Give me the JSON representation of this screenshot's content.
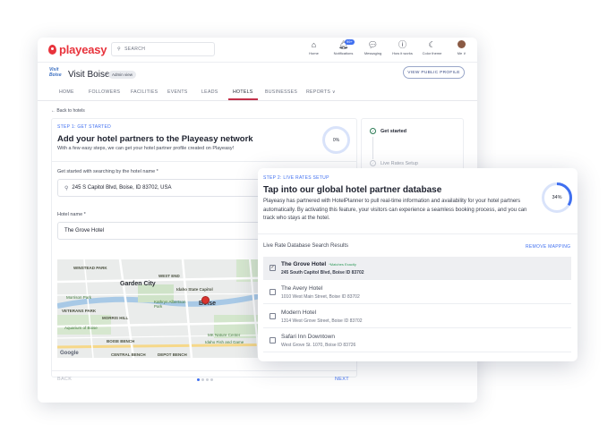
{
  "brand": {
    "name": "playeasy",
    "accent": "#e8333c",
    "link_color": "#3f6ff0"
  },
  "topbar": {
    "search_placeholder": "SEARCH",
    "nav": [
      {
        "icon": "home-icon",
        "glyph": "⌂",
        "label": "Home"
      },
      {
        "icon": "bell-icon",
        "glyph": "♪",
        "label": "Notifications",
        "badge": "99+"
      },
      {
        "icon": "chat-icon",
        "glyph": "✉",
        "label": "Messaging"
      },
      {
        "icon": "help-icon",
        "glyph": "?",
        "label": "How it works"
      },
      {
        "icon": "moon-icon",
        "glyph": "☾",
        "label": "Color theme"
      },
      {
        "icon": "avatar-icon",
        "glyph": "",
        "label": "Me ∨"
      }
    ]
  },
  "org": {
    "logo_text": "Visit Boise",
    "name": "Visit Boise",
    "badge": "Admin view",
    "public_button": "VIEW PUBLIC PROFILE"
  },
  "tabs": [
    "HOME",
    "FOLLOWERS",
    "FACILITIES",
    "EVENTS",
    "LEADS",
    "HOTELS",
    "BUSINESSES",
    "REPORTS ∨"
  ],
  "active_tab": "HOTELS",
  "back_link": "← Back to hotels",
  "step1": {
    "label": "STEP 1: GET STARTED",
    "title": "Add your hotel partners to the Playeasy network",
    "subtitle": "With a few easy steps, we can get your hotel partner profile created on Playeasy!",
    "progress": "0%",
    "search_label": "Get started with searching by the hotel name *",
    "search_value": "245 S Capitol Blvd, Boise, ID 83702, USA",
    "hotel_label": "Hotel name *",
    "hotel_value": "The Grove Hotel"
  },
  "map": {
    "labels": [
      "WINSTEAD PARK",
      "Garden City",
      "WEST END",
      "Morrison Park",
      "Idaho State Capitol",
      "Kathryn Albertson Park",
      "VETERANS PARK",
      "MORRIS HILL",
      "Aquarium of Boise",
      "BOISE BENCH",
      "CENTRAL BENCH",
      "DEPOT BENCH",
      "MK Nature Center",
      "Idaho Fish and Game",
      "Boise"
    ],
    "google": "Google",
    "attribution": "Keyboard shortcuts"
  },
  "footer": {
    "back": "BACK",
    "next": "NEXT"
  },
  "steps_panel": [
    {
      "label": "Get started",
      "state": "done"
    },
    {
      "label": "Live Rates Setup",
      "state": "pending"
    }
  ],
  "step2": {
    "label": "STEP 2: LIVE RATES SETUP",
    "title": "Tap into our global hotel partner database",
    "description": "Playeasy has partnered with HotelPlanner to pull real-time information and availability for your hotel partners automatically. By activating this feature, your visitors can experience a seamless booking process, and you can track who stays at the hotel.",
    "progress": "34%",
    "progress_value": 0.34,
    "results_label": "Live Rate Database Search Results",
    "remove_label": "REMOVE MAPPING",
    "results": [
      {
        "name": "The Grove Hotel",
        "match": "*Matches Exactly",
        "address": "245 South Capitol Blvd, Boise ID 83702",
        "checked": true
      },
      {
        "name": "The Avery Hotel",
        "match": "",
        "address": "1010 West Main Street, Boise ID 83702",
        "checked": false
      },
      {
        "name": "Modern Hotel",
        "match": "",
        "address": "1314 West Grove Street, Boise ID 83702",
        "checked": false
      },
      {
        "name": "Safari Inn Downtown",
        "match": "",
        "address": "West Grove St. 1070, Boise ID 83726",
        "checked": false
      }
    ]
  }
}
